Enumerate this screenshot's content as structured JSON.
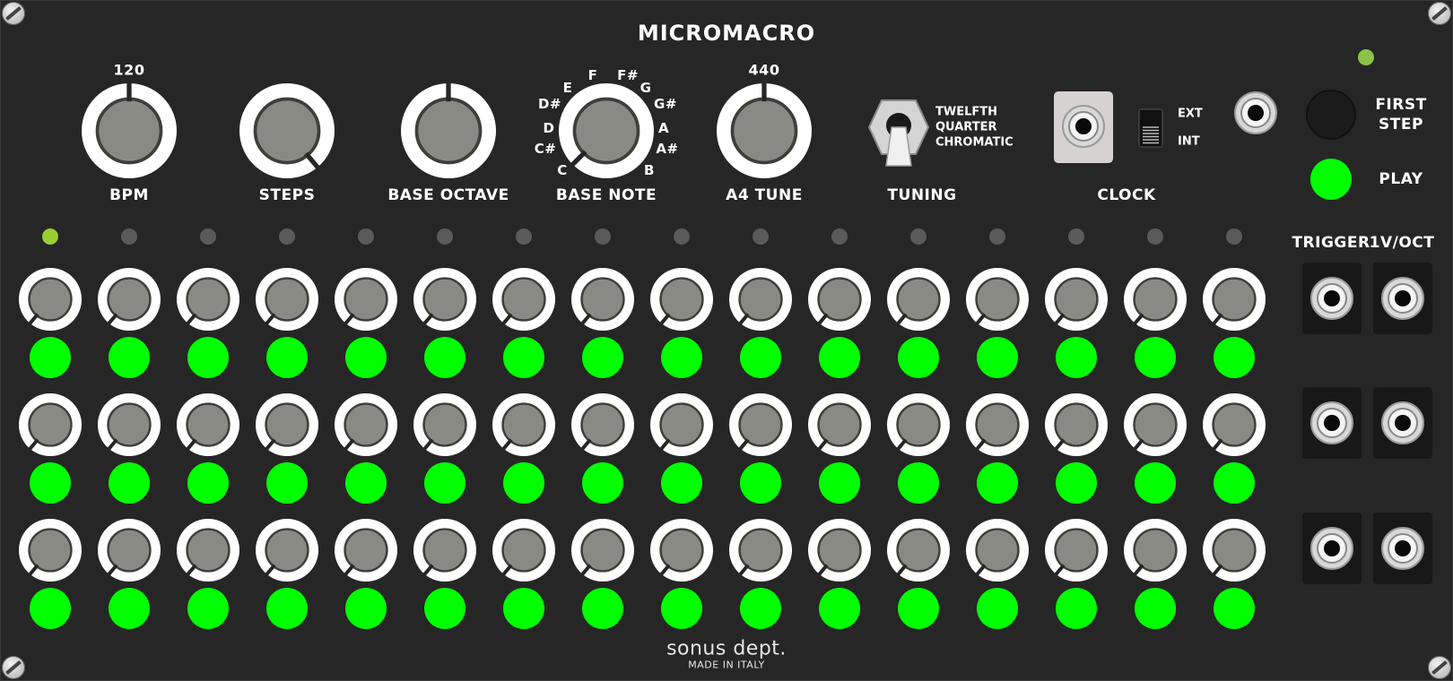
{
  "module": {
    "title": "MICROMACRO",
    "brand": "sonus dept.",
    "brand_sub": "MADE IN ITALY"
  },
  "knobs": {
    "bpm": {
      "label": "BPM",
      "value": "120"
    },
    "steps": {
      "label": "STEPS"
    },
    "base_octave": {
      "label": "BASE OCTAVE"
    },
    "base_note": {
      "label": "BASE NOTE",
      "notes": [
        "C",
        "C#",
        "D",
        "D#",
        "E",
        "F",
        "F#",
        "G",
        "G#",
        "A",
        "A#",
        "B"
      ]
    },
    "a4_tune": {
      "label": "A4 TUNE",
      "value": "440"
    }
  },
  "tuning": {
    "label": "TUNING",
    "options": [
      "TWELFTH",
      "QUARTER",
      "CHROMATIC"
    ]
  },
  "clock": {
    "label": "CLOCK",
    "options": [
      "EXT",
      "INT"
    ]
  },
  "controls": {
    "first_step": [
      "FIRST",
      "STEP"
    ],
    "play": "PLAY"
  },
  "outputs": {
    "trigger_label": "TRIGGER",
    "voct_label": "1V/OCT"
  },
  "sequencer": {
    "steps": 16,
    "rows": 3,
    "active_step": 1,
    "active_color": "#9acd32",
    "inactive_color": "#5a5a5a",
    "gate_color": "#00ff00"
  },
  "colors": {
    "panel": "#262626",
    "knob_ring": "#ffffff",
    "knob_cap": "#8a8a85",
    "led_green": "#00ff00",
    "led_small": "#8bc34a"
  }
}
